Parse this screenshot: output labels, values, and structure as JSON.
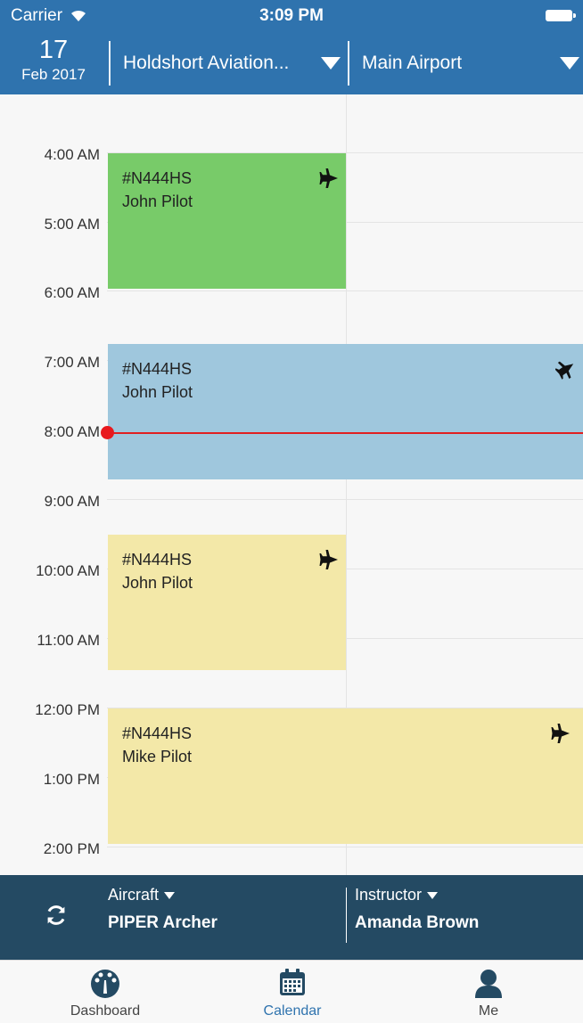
{
  "status_bar": {
    "carrier": "Carrier",
    "time": "3:09 PM"
  },
  "header": {
    "day": "17",
    "month_year": "Feb 2017",
    "organization": "Holdshort Aviation...",
    "location": "Main Airport"
  },
  "time_labels": [
    "4:00 AM",
    "5:00 AM",
    "6:00 AM",
    "7:00 AM",
    "8:00 AM",
    "9:00 AM",
    "10:00 AM",
    "11:00 AM",
    "12:00 PM",
    "1:00 PM",
    "2:00 PM"
  ],
  "events": [
    {
      "aircraft": "#N444HS",
      "pilot": "John Pilot",
      "color": "#78cb69"
    },
    {
      "aircraft": "#N444HS",
      "pilot": "John Pilot",
      "color": "#9fc7dd"
    },
    {
      "aircraft": "#N444HS",
      "pilot": "John Pilot",
      "color": "#f3e8a8"
    },
    {
      "aircraft": "#N444HS",
      "pilot": "Mike Pilot",
      "color": "#f3e8a8"
    }
  ],
  "filters": {
    "aircraft_label": "Aircraft",
    "aircraft_value": "PIPER Archer",
    "instructor_label": "Instructor",
    "instructor_value": "Amanda Brown"
  },
  "tabs": [
    "Dashboard",
    "Calendar",
    "Me"
  ],
  "colors": {
    "header": "#2f73ae",
    "filter_bar": "#244a63",
    "now_line": "#e02020",
    "active_tab": "#2f73ae"
  }
}
